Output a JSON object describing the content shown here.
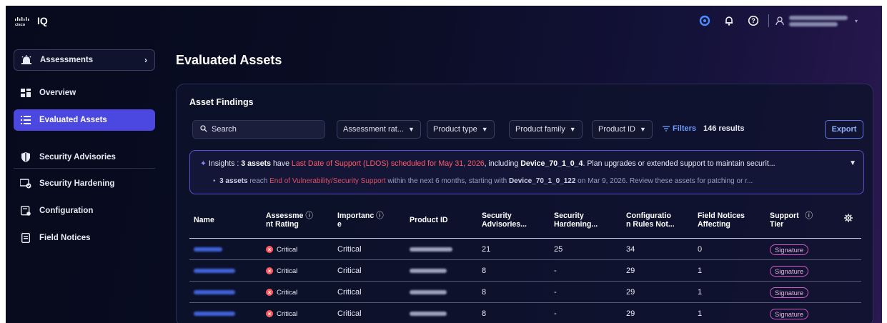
{
  "app": {
    "brand": "IQ"
  },
  "header": {
    "icons": [
      "refresh-icon",
      "bell-icon",
      "help-icon",
      "user-icon"
    ]
  },
  "sidebar": {
    "items": [
      {
        "label": "Assessments",
        "icon": "alarm-icon"
      },
      {
        "label": "Overview",
        "icon": "dashboard-icon"
      },
      {
        "label": "Evaluated Assets",
        "icon": "list-icon",
        "active": true
      },
      {
        "label": "Security Advisories",
        "icon": "shield-icon"
      },
      {
        "label": "Security Hardening",
        "icon": "hardening-icon"
      },
      {
        "label": "Configuration",
        "icon": "config-icon"
      },
      {
        "label": "Field Notices",
        "icon": "document-icon"
      }
    ]
  },
  "main": {
    "title": "Evaluated Assets",
    "card_title": "Asset Findings",
    "search_placeholder": "Search",
    "filters": [
      "Assessment rat...",
      "Product type",
      "Product family",
      "Product ID"
    ],
    "filters_link": "Filters",
    "results": "146 results",
    "export": "Export"
  },
  "insights": {
    "prefix": "Insights : ",
    "l1_a": "3 assets",
    "l1_b": " have ",
    "l1_c": "Last Date of Support (LDOS) scheduled for May 31, 2026",
    "l1_d": ", including ",
    "l1_e": "Device_70_1_0_4",
    "l1_f": ". Plan upgrades or extended support to maintain securit...",
    "l2_bullet": "•",
    "l2_a": "3 assets",
    "l2_b": " reach ",
    "l2_c": "End of Vulnerability/Security Support",
    "l2_d": " within the next 6 months, starting with ",
    "l2_e": "Device_70_1_0_122",
    "l2_f": " on Mar 9, 2026. Review these assets for patching or r..."
  },
  "table": {
    "headers": [
      {
        "line1": "Name",
        "line2": ""
      },
      {
        "line1": "Assessme",
        "line2": "nt Rating",
        "info": "ⓘ"
      },
      {
        "line1": "Importanc",
        "line2": "e",
        "info": "ⓘ"
      },
      {
        "line1": "Product ID",
        "line2": ""
      },
      {
        "line1": "Security",
        "line2": "Advisories..."
      },
      {
        "line1": "Security",
        "line2": "Hardening..."
      },
      {
        "line1": "Configuratio",
        "line2": "n Rules Not..."
      },
      {
        "line1": "Field Notices",
        "line2": "Affecting"
      },
      {
        "line1": "Support",
        "line2": "Tier",
        "info": "ⓘ"
      }
    ],
    "rows": [
      {
        "rating": "Critical",
        "importance": "Critical",
        "advisories": "21",
        "hardening": "25",
        "config": "34",
        "field_notices": "0",
        "tier": "Signature"
      },
      {
        "rating": "Critical",
        "importance": "Critical",
        "advisories": "8",
        "hardening": "-",
        "config": "29",
        "field_notices": "1",
        "tier": "Signature"
      },
      {
        "rating": "Critical",
        "importance": "Critical",
        "advisories": "8",
        "hardening": "-",
        "config": "29",
        "field_notices": "1",
        "tier": "Signature"
      },
      {
        "rating": "Critical",
        "importance": "Critical",
        "advisories": "8",
        "hardening": "-",
        "config": "29",
        "field_notices": "1",
        "tier": "Signature"
      }
    ]
  },
  "colors": {
    "accent": "#4a48e0",
    "critical": "#ff5a5f",
    "link": "#6f9bff",
    "badge": "#d35ac8"
  }
}
